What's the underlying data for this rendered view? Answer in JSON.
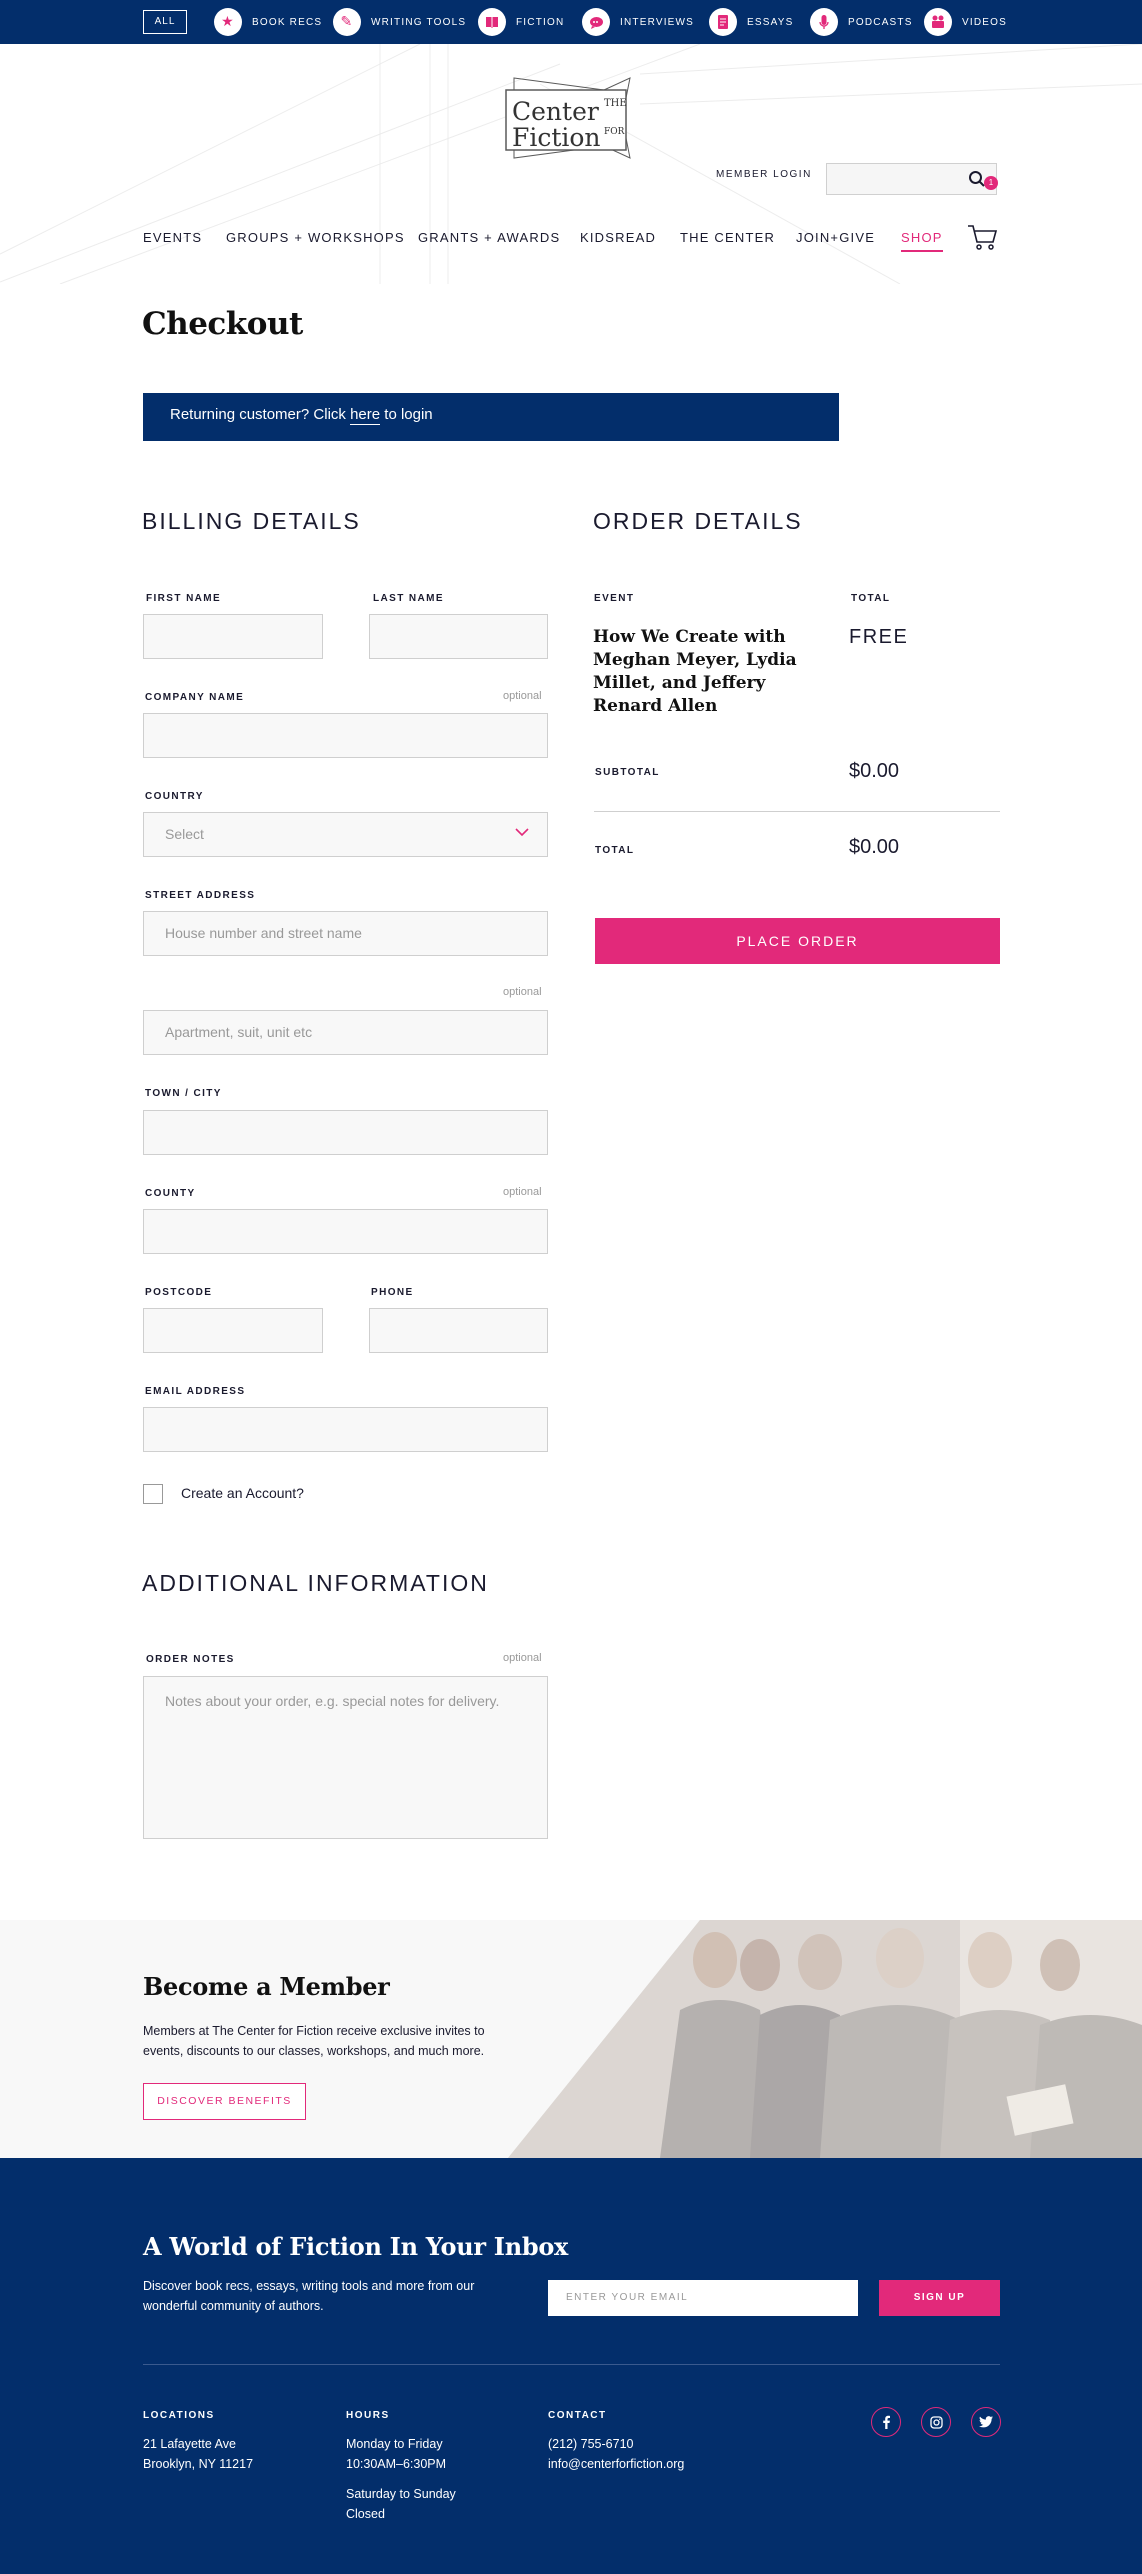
{
  "topbar": {
    "all_label": "ALL",
    "categories": [
      {
        "label": "BOOK RECS",
        "icon": "star-icon"
      },
      {
        "label": "WRITING TOOLS",
        "icon": "pen-icon"
      },
      {
        "label": "FICTION",
        "icon": "book-icon"
      },
      {
        "label": "INTERVIEWS",
        "icon": "speech-bubble-icon"
      },
      {
        "label": "ESSAYS",
        "icon": "document-icon"
      },
      {
        "label": "PODCASTS",
        "icon": "microphone-icon"
      },
      {
        "label": "VIDEOS",
        "icon": "video-camera-icon"
      }
    ]
  },
  "header": {
    "logo": {
      "the": "THE",
      "center": "Center",
      "for": "FOR",
      "fiction": "Fiction"
    },
    "member_login": "MEMBER LOGIN",
    "nav": [
      "EVENTS",
      "GROUPS + WORKSHOPS",
      "GRANTS + AWARDS",
      "KIDSREAD",
      "THE CENTER",
      "JOIN+GIVE",
      "SHOP"
    ],
    "active_nav": "SHOP",
    "cart_count": "1"
  },
  "checkout": {
    "title": "Checkout",
    "returning_prefix": "Returning customer?  Click ",
    "returning_link": "here",
    "returning_suffix": " to login"
  },
  "billing": {
    "heading": "BILLING DETAILS",
    "optional": "optional",
    "first_name": "FIRST NAME",
    "last_name": "LAST NAME",
    "company_name": "COMPANY NAME",
    "country": "COUNTRY",
    "country_placeholder": "Select",
    "street_address": "STREET ADDRESS",
    "street_placeholder": "House number and street name",
    "apartment_placeholder": "Apartment, suit, unit etc",
    "town_city": "TOWN / CITY",
    "county": "COUNTY",
    "postcode": "POSTCODE",
    "phone": "PHONE",
    "email": "EMAIL ADDRESS",
    "create_account": "Create an Account?"
  },
  "additional": {
    "heading": "ADDITIONAL INFORMATION",
    "order_notes": "ORDER NOTES",
    "optional": "optional",
    "notes_placeholder": "Notes about your order, e.g. special notes for delivery."
  },
  "order": {
    "heading": "ORDER DETAILS",
    "col_event": "EVENT",
    "col_total": "TOTAL",
    "event_title": "How We Create with Meghan Meyer, Lydia Millet, and Jeffery Renard Allen",
    "event_price": "FREE",
    "subtotal_label": "SUBTOTAL",
    "subtotal_value": "$0.00",
    "total_label": "TOTAL",
    "total_value": "$0.00",
    "place_order": "PLACE ORDER"
  },
  "member": {
    "title": "Become a Member",
    "text": "Members at The Center for Fiction receive exclusive invites to events, discounts to our classes, workshops, and much more.",
    "button": "DISCOVER BENEFITS"
  },
  "footer": {
    "news_title": "A World of Fiction In Your Inbox",
    "news_text": "Discover book recs, essays, writing tools and more from our wonderful community of authors.",
    "email_placeholder": "ENTER YOUR EMAIL",
    "signup": "SIGN UP",
    "locations_head": "LOCATIONS",
    "address1": "21 Lafayette Ave",
    "address2": "Brooklyn, NY 11217",
    "hours_head": "HOURS",
    "hours1": "Monday to Friday",
    "hours2": "10:30AM–6:30PM",
    "hours3": "Saturday to Sunday",
    "hours4": "Closed",
    "contact_head": "CONTACT",
    "phone": "(212) 755-6710",
    "email": "info@centerforfiction.org",
    "social": [
      "facebook-icon",
      "instagram-icon",
      "twitter-icon"
    ]
  },
  "colors": {
    "navy": "#032e6b",
    "pink": "#e2297a",
    "field_bg": "#f8f8f8"
  }
}
